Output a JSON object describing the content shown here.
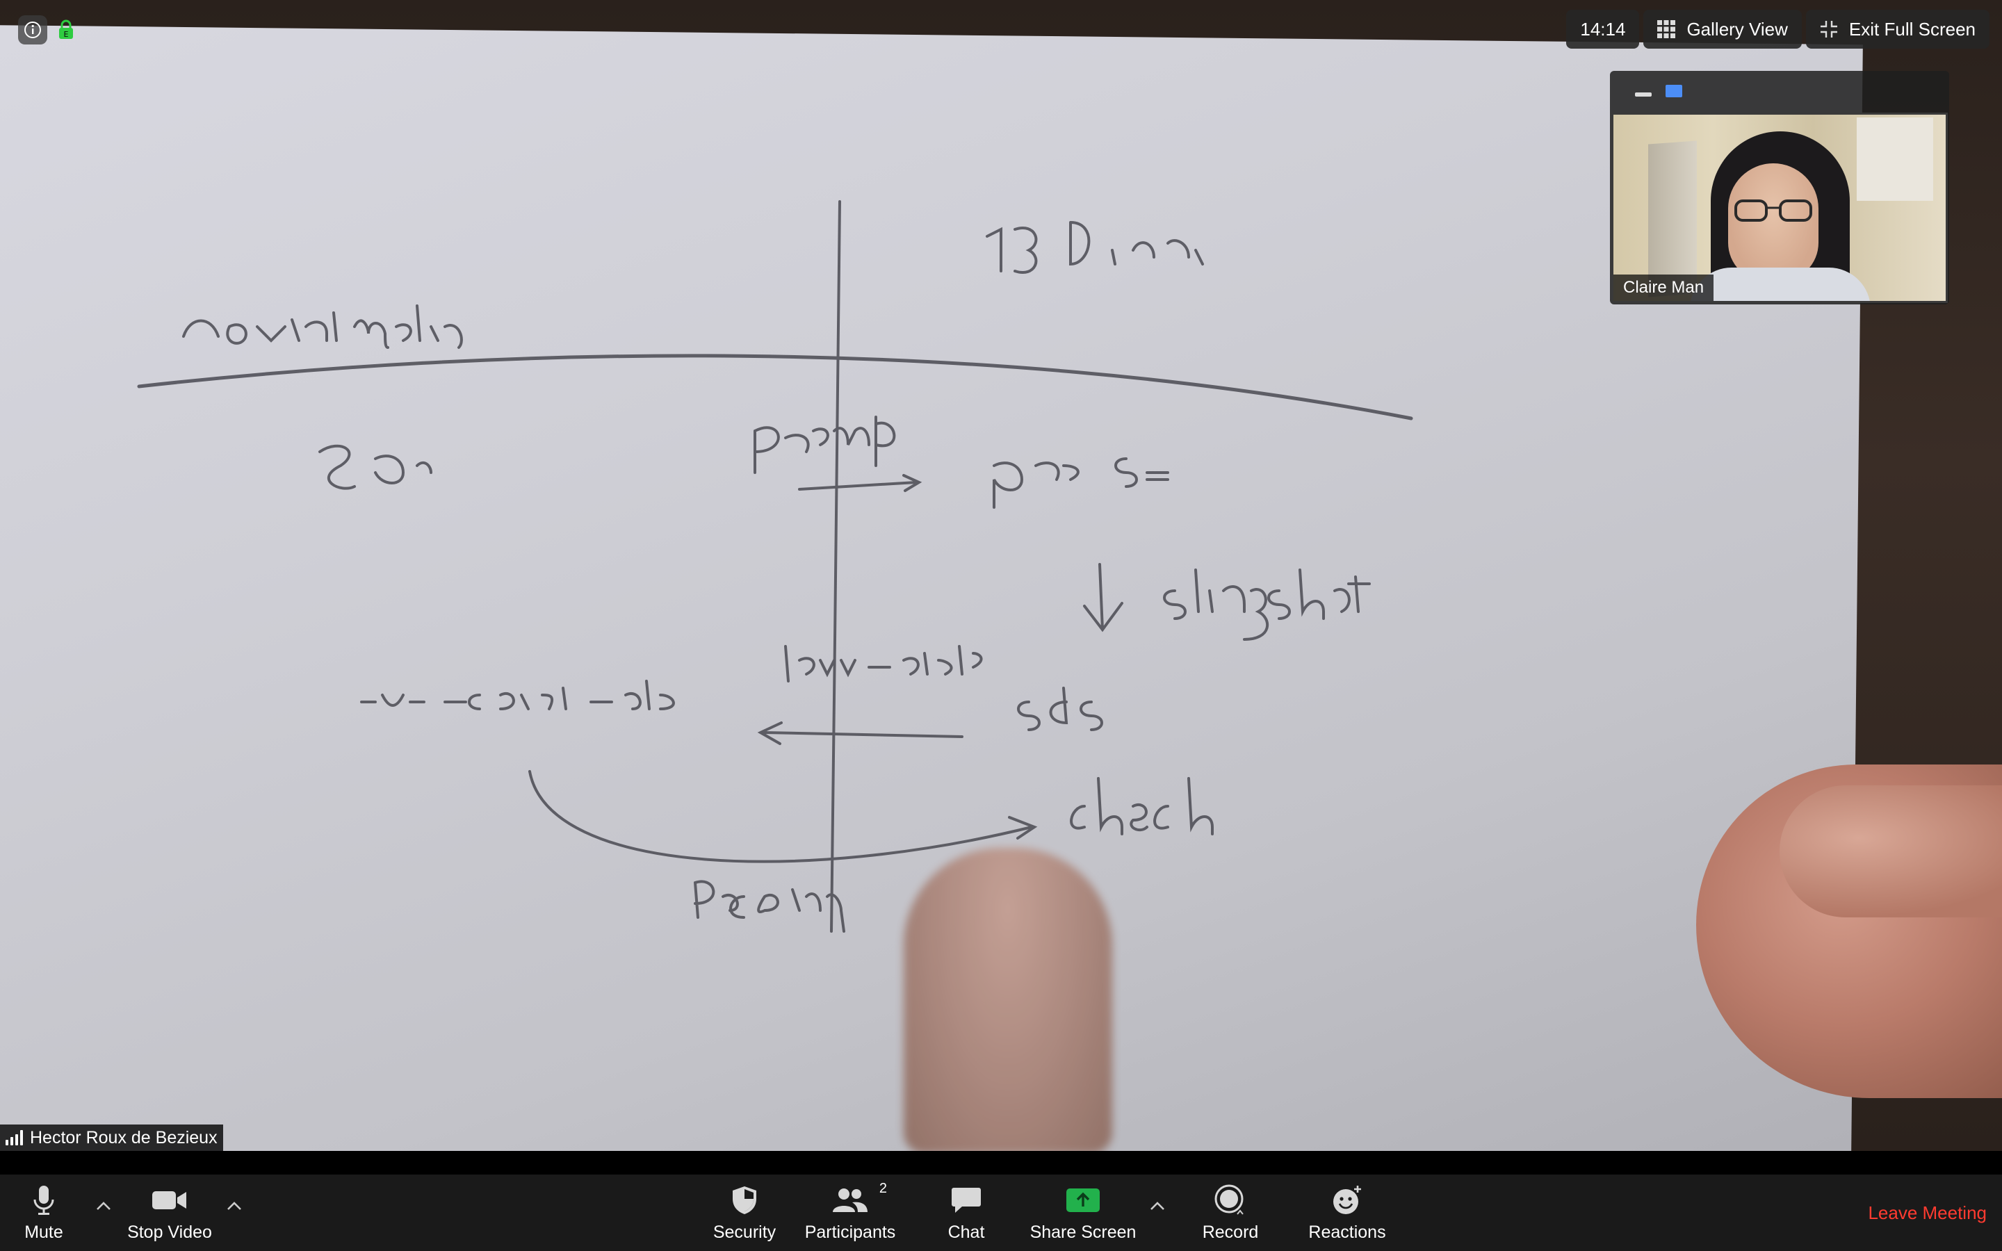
{
  "top_bar": {
    "time": "14:14",
    "gallery_view_label": "Gallery View",
    "exit_full_screen_label": "Exit Full Screen"
  },
  "thumbnail": {
    "participant_name": "Claire Man"
  },
  "main_video": {
    "speaker_name": "Hector Roux de Bezieux"
  },
  "toolbar": {
    "mute_label": "Mute",
    "stop_video_label": "Stop Video",
    "security_label": "Security",
    "participants_label": "Participants",
    "participants_count": "2",
    "chat_label": "Chat",
    "share_screen_label": "Share Screen",
    "record_label": "Record",
    "reactions_label": "Reactions",
    "leave_label": "Leave Meeting"
  },
  "colors": {
    "toolbar_bg": "#1a1a1a",
    "share_green": "#22b14c",
    "leave_red": "#ff3b30",
    "accent_blue": "#4c8ef7"
  },
  "icons": [
    "info-icon",
    "lock-icon",
    "gallery-grid-icon",
    "exit-fullscreen-icon",
    "minimize-icon",
    "view-toggle-icon",
    "signal-icon",
    "microphone-icon",
    "camera-icon",
    "shield-icon",
    "participants-icon",
    "chat-bubble-icon",
    "share-arrow-icon",
    "record-icon",
    "reaction-smiley-icon",
    "chevron-up-icon"
  ]
}
